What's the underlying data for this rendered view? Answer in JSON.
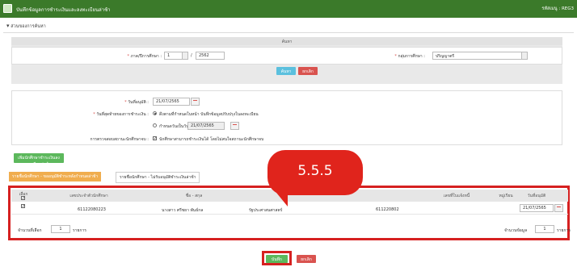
{
  "header": {
    "title": "บันทึกข้อมูลการชำระเงินและลงทะเบียนล่าช้า",
    "code": "รหัสเมนู : REG3"
  },
  "section": {
    "toggle_label": "ส่วนของการค้นหา"
  },
  "search": {
    "panel_title": "ค้นหา",
    "term_label": "ภาค/ปีการศึกษา :",
    "term_value": "1",
    "year_value": "2562",
    "level_label": "กลุ่มการศึกษา :",
    "level_value": "ปริญญาตรี",
    "search_button": "ค้นหา",
    "cancel_button": "ยกเลิก"
  },
  "form": {
    "record_date_label": "วันที่อนุมัติ :",
    "record_date_value": "21/07/2565",
    "deadline_label": "วันที่สุดท้ายของการชำระเงิน :",
    "option1_label": "ดึงตามที่กำหนดในหน้า บันทึกข้อมูลปรับปรุงในลงทะเบียน",
    "option2_label": "กำหนดวันเป็นวันที่",
    "option2_date": "21/07/2565",
    "check_label": "การตรวจสอบสถานะนักศึกษาจบ :",
    "check_text": "นักศึกษาสามารถชำระเงินได้ โดยไม่สนใจสถานะนักศึกษาจบ"
  },
  "add_button": "เพิ่มนักศึกษาชำระเงินลงทะเบียนล่าช้า",
  "tabs": [
    {
      "label": "รายชื่อนักศึกษา - ขออนุมัติชำระหลังกำหนดล่าช้า"
    },
    {
      "label": "รายชื่อนักศึกษา - ไม่รับอนุมัติชำระเงินล่าช้า"
    }
  ],
  "table": {
    "headers": [
      "เลือก",
      "เลขประจำตัวนักศึกษา",
      "ชื่อ - สกุล",
      "",
      "หมู่เรียน",
      "เลขที่ใบแจ้งหนี้",
      "วันที่อนุมัติ"
    ],
    "rows": [
      {
        "student_id": "61122080223",
        "name": "นางสาว ศรีชยา พันธ์กล",
        "faculty": "รัฐประศาสนศาสตร์",
        "group": "611220802",
        "invoice": "",
        "date": "21/07/2565"
      }
    ],
    "selected_count_label": "จำนวนที่เลือก",
    "selected_count": "1",
    "selected_unit": "รายการ",
    "total_label": "จำนวนข้อมูล",
    "total_count": "1",
    "total_unit": "รายการ"
  },
  "callout": {
    "text": "5.5.5"
  },
  "footer": {
    "save_button": "บันทึก",
    "cancel_button": "ยกเลิก"
  },
  "colors": {
    "header_bg": "#3b7a2a",
    "accent_red": "#d62020",
    "tab_active": "#f0ad4e"
  }
}
